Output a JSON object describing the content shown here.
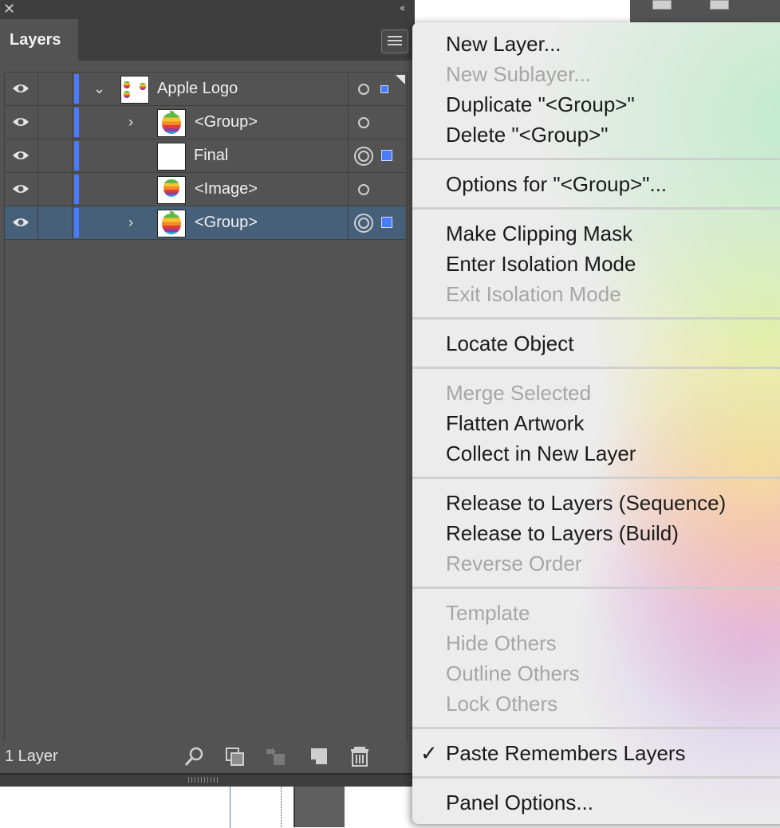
{
  "panel": {
    "close_glyph": "✕",
    "collapse_glyph": "‹‹",
    "tab_label": "Layers",
    "footer_count": "1 Layer",
    "layer_color": "#4a7bff",
    "rows": [
      {
        "label": "Apple Logo",
        "disclosure": "expanded"
      },
      {
        "label": "<Group>",
        "disclosure": "collapsed"
      },
      {
        "label": "Final",
        "disclosure": "none"
      },
      {
        "label": "<Image>",
        "disclosure": "none"
      },
      {
        "label": "<Group>",
        "disclosure": "collapsed",
        "selected": true
      }
    ],
    "footer_buttons": [
      "locate-object",
      "make-clipping-mask",
      "create-sublayer",
      "create-new-layer",
      "delete-selection"
    ]
  },
  "menu": {
    "items": [
      {
        "label": "New Layer...",
        "enabled": true
      },
      {
        "label": "New Sublayer...",
        "enabled": false
      },
      {
        "label": "Duplicate \"<Group>\"",
        "enabled": true
      },
      {
        "label": "Delete \"<Group>\"",
        "enabled": true
      },
      {
        "label": "Options for \"<Group>\"...",
        "enabled": true
      },
      {
        "label": "Make Clipping Mask",
        "enabled": true
      },
      {
        "label": "Enter Isolation Mode",
        "enabled": true
      },
      {
        "label": "Exit Isolation Mode",
        "enabled": false
      },
      {
        "label": "Locate Object",
        "enabled": true
      },
      {
        "label": "Merge Selected",
        "enabled": false
      },
      {
        "label": "Flatten Artwork",
        "enabled": true
      },
      {
        "label": "Collect in New Layer",
        "enabled": true
      },
      {
        "label": "Release to Layers (Sequence)",
        "enabled": true
      },
      {
        "label": "Release to Layers (Build)",
        "enabled": true
      },
      {
        "label": "Reverse Order",
        "enabled": false
      },
      {
        "label": "Template",
        "enabled": false
      },
      {
        "label": "Hide Others",
        "enabled": false
      },
      {
        "label": "Outline Others",
        "enabled": false
      },
      {
        "label": "Lock Others",
        "enabled": false
      },
      {
        "label": "Paste Remembers Layers",
        "enabled": true,
        "checked": true
      },
      {
        "label": "Panel Options...",
        "enabled": true
      }
    ],
    "check_glyph": "✓"
  }
}
